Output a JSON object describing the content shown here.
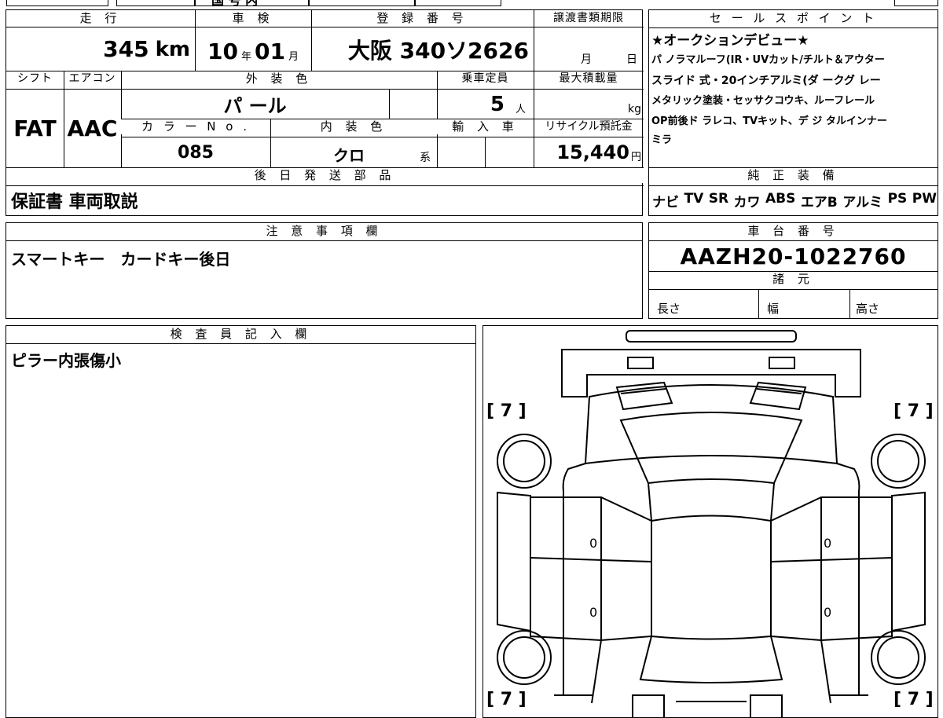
{
  "top_strip": {
    "cells": [
      "",
      "",
      "国 号 内",
      "",
      "",
      ""
    ]
  },
  "basic": {
    "mileage_header": "走 行",
    "mileage_value": "345",
    "mileage_unit": "km",
    "shaken_header": "車 検",
    "shaken_year": "10",
    "shaken_year_unit": "年",
    "shaken_month": "01",
    "shaken_month_unit": "月",
    "registration_header": "登 録 番 号",
    "registration_value": "大阪 340ソ2626",
    "transfer_header": "譲渡書類期限",
    "transfer_month_unit": "月",
    "transfer_day_unit": "日"
  },
  "details": {
    "shift_header": "シフト",
    "shift_value": "FAT",
    "ac_header": "エアコン",
    "ac_value": "AAC",
    "exterior_color_header": "外 装 色",
    "exterior_color_value": "パ ール",
    "capacity_header": "乗車定員",
    "capacity_value": "5",
    "capacity_unit": "人",
    "load_header": "最大積載量",
    "load_unit": "kg",
    "color_no_header": "カ ラ ー N o .",
    "color_no_value": "085",
    "interior_header": "内 装 色",
    "interior_value": "クロ",
    "interior_suffix": "系",
    "import_header": "輸 入 車",
    "recycle_header": "リサイクル預託金",
    "recycle_value": "15,440",
    "recycle_unit": "円"
  },
  "later_parts": {
    "header": "後 日 発 送 部 品",
    "text": "保証書 車両取説"
  },
  "notes": {
    "header": "注 意 事 項 欄",
    "text": "スマートキー　カードキー後日"
  },
  "inspector": {
    "header": "検 査 員 記 入 欄",
    "text": "ピラー内張傷小"
  },
  "sales_points": {
    "header": "セ ー ル ス ポ イ ン ト",
    "lines": [
      "★オークションデビュー★",
      "パ ノラマルーフ(IR・UVカット/チルト＆アウター",
      "スライド 式・20インチアルミ(ダ ークグ レー",
      "メタリック塗装・セッサクコウキ、ルーフレール",
      "OP前後ド ラレコ、TVキット、デ ジ タルインナー",
      "ミラ"
    ]
  },
  "equipment": {
    "header": "純 正 装 備",
    "items": [
      "ナビ ",
      "TV",
      "SR",
      "カワ",
      "ABS",
      "エアB",
      "アルミ",
      "PS",
      "PW"
    ]
  },
  "chassis": {
    "header": "車 台 番 号",
    "value": "AAZH20-1022760"
  },
  "specs": {
    "header": "諸 元",
    "length_label": "長さ",
    "width_label": "幅",
    "height_label": "高さ"
  },
  "diagram": {
    "tire_top_left": "[ 7 ]",
    "tire_top_right": "[ 7 ]",
    "tire_bottom_left": "[ 7 ]",
    "tire_bottom_right": "[ 7 ]",
    "door_fl": "0",
    "door_fr": "0",
    "door_rl": "0",
    "door_rr": "0"
  }
}
